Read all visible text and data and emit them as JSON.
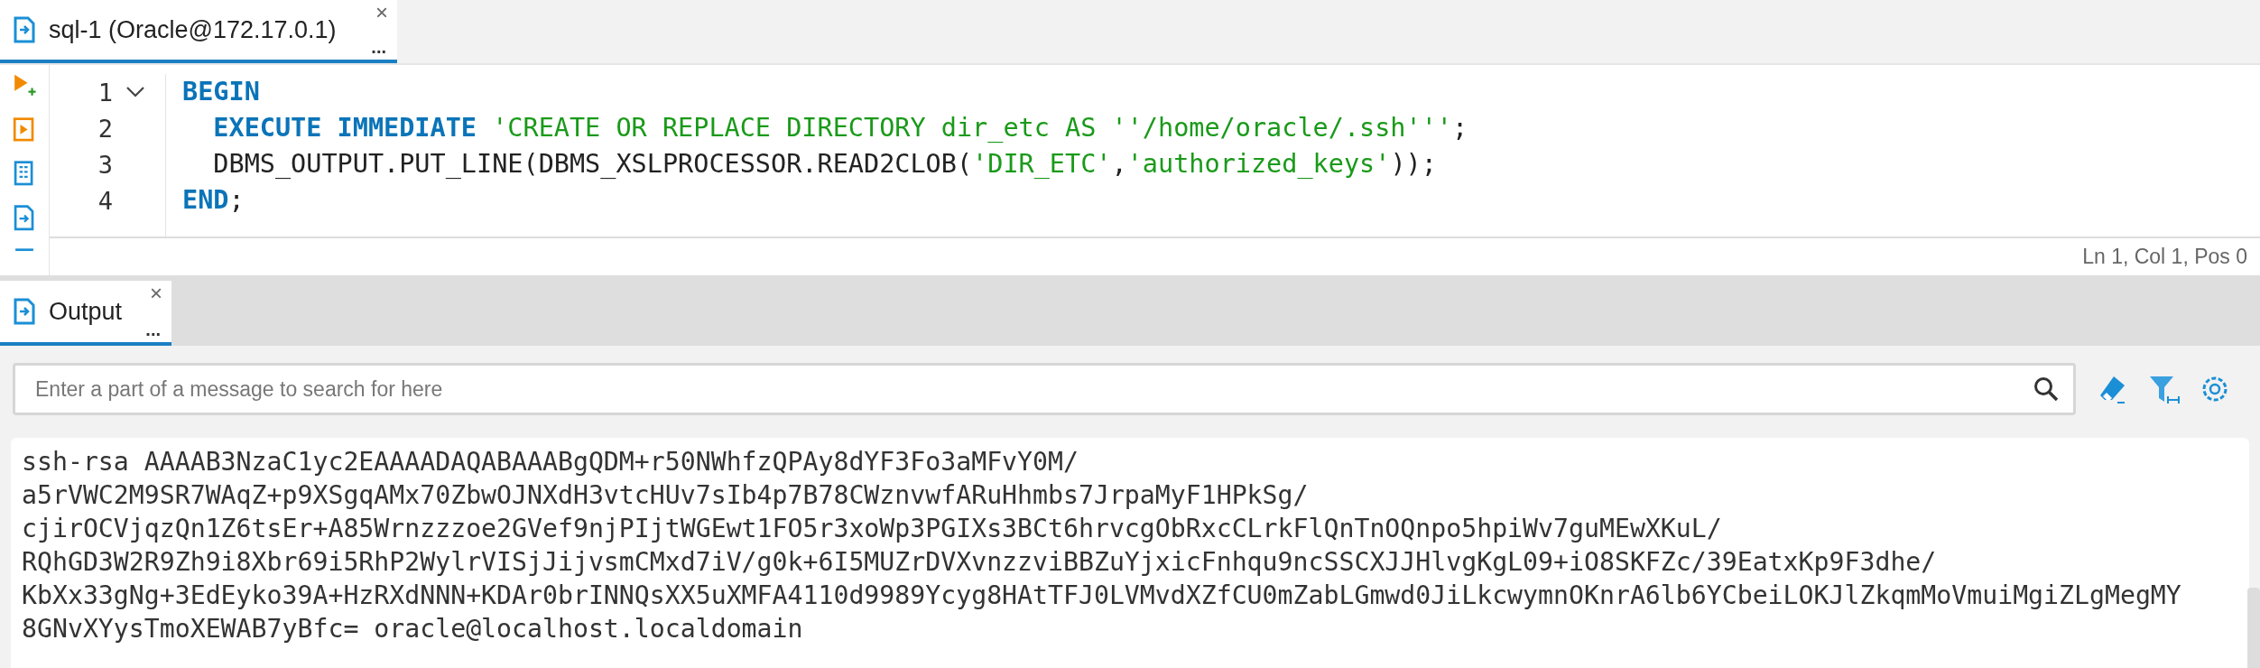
{
  "editor_tabs": [
    {
      "label": "sql-1 (Oracle@172.17.0.1)",
      "selected": true,
      "close": "×",
      "more": "..."
    }
  ],
  "editor": {
    "lines": [
      {
        "number": "1",
        "indented": false,
        "fold": {
          "expanded": true
        },
        "tokens": [
          {
            "text": "BEGIN",
            "kind": "keyword"
          }
        ]
      },
      {
        "number": "2",
        "indented": true,
        "tokens": [
          {
            "text": "EXECUTE IMMEDIATE ",
            "kind": "keyword"
          },
          {
            "text": "'CREATE OR REPLACE DIRECTORY dir_etc AS ''/home/oracle/.ssh'''",
            "kind": "string"
          },
          {
            "text": ";",
            "kind": "plain"
          }
        ]
      },
      {
        "number": "3",
        "indented": true,
        "tokens": [
          {
            "text": "DBMS_OUTPUT.PUT_LINE(DBMS_XSLPROCESSOR.READ2CLOB(",
            "kind": "plain"
          },
          {
            "text": "'DIR_ETC'",
            "kind": "string"
          },
          {
            "text": ",",
            "kind": "plain"
          },
          {
            "text": "'authorized_keys'",
            "kind": "string"
          },
          {
            "text": "));",
            "kind": "plain"
          }
        ]
      },
      {
        "number": "4",
        "indented": false,
        "tokens": [
          {
            "text": "END",
            "kind": "keyword"
          },
          {
            "text": ";",
            "kind": "plain"
          }
        ]
      }
    ],
    "status": "Ln 1, Col 1, Pos 0"
  },
  "output_tabs": [
    {
      "label": "Output",
      "selected": true,
      "close": "×",
      "more": "..."
    }
  ],
  "search": {
    "placeholder": "Enter a part of a message to search for here"
  },
  "output_lines": [
    "ssh-rsa AAAAB3NzaC1yc2EAAAADAQABAAABgQDM+r50NWhfzQPAy8dYF3Fo3aMFvY0M/",
    "a5rVWC2M9SR7WAqZ+p9XSgqAMx70ZbwOJNXdH3vtcHUv7sIb4p7B78CWznvwfARuHhmbs7JrpaMyF1HPkSg/",
    "cjirOCVjqzQn1Z6tsEr+A85Wrnzzzoe2GVef9njPIjtWGEwt1FO5r3xoWp3PGIXs3BCt6hrvcgObRxcCLrkFlQnTnOQnpo5hpiWv7guMEwXKuL/",
    "RQhGD3W2R9Zh9i8Xbr69i5RhP2WylrVISjJijvsmCMxd7iV/g0k+6I5MUZrDVXvnzzviBBZuYjxicFnhqu9ncSSCXJJHlvgKgL09+iO8SKFZc/39EatxKp9F3dhe/",
    "KbXx33gNg+3EdEyko39A+HzRXdNNN+KDAr0brINNQsXX5uXMFA4110d9989Ycyg8HAtTFJ0LVMvdXZfCU0mZabLGmwd0JiLkcwymnOKnrA6lb6YCbeiLOKJlZkqmMoVmuiMgiZLgMegMY",
    "8GNvXYysTmoXEWAB7yBfc= oracle@localhost.localdomain"
  ]
}
